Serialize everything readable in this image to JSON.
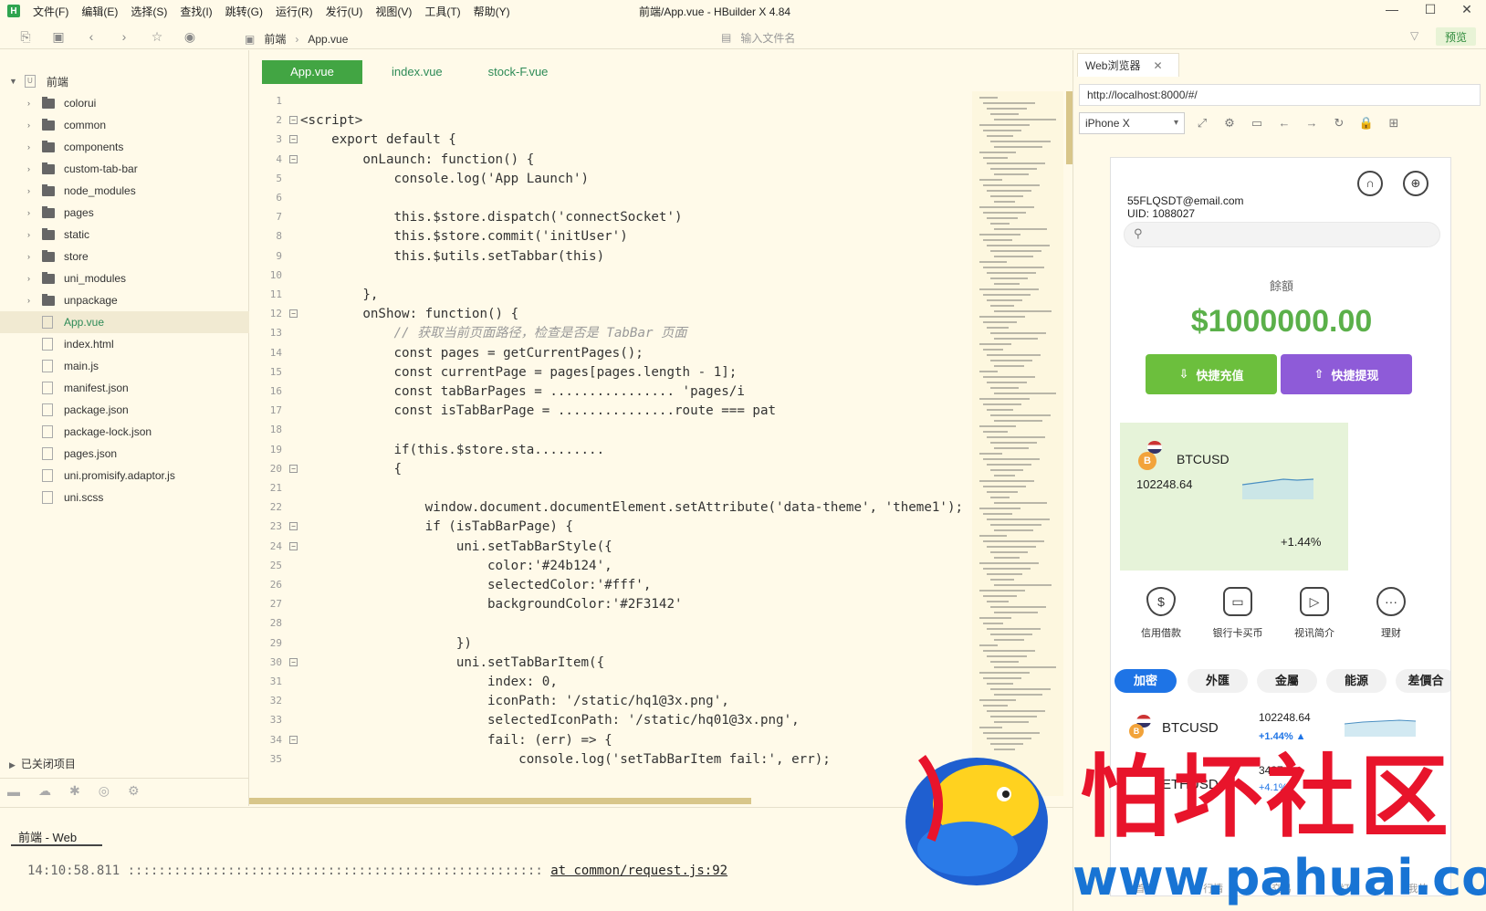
{
  "window": {
    "title": "前端/App.vue - HBuilder X 4.84",
    "logo": "H"
  },
  "menu": [
    "文件(F)",
    "编辑(E)",
    "选择(S)",
    "查找(I)",
    "跳转(G)",
    "运行(R)",
    "发行(U)",
    "视图(V)",
    "工具(T)",
    "帮助(Y)"
  ],
  "breadcrumb": {
    "project": "前端",
    "file": "App.vue"
  },
  "file_search": {
    "placeholder": "输入文件名"
  },
  "preview_label": "预览",
  "project_tree": {
    "root": "前端",
    "items": [
      {
        "label": "colorui",
        "type": "folder"
      },
      {
        "label": "common",
        "type": "folder"
      },
      {
        "label": "components",
        "type": "folder"
      },
      {
        "label": "custom-tab-bar",
        "type": "folder"
      },
      {
        "label": "node_modules",
        "type": "folder"
      },
      {
        "label": "pages",
        "type": "folder"
      },
      {
        "label": "static",
        "type": "folder"
      },
      {
        "label": "store",
        "type": "folder"
      },
      {
        "label": "uni_modules",
        "type": "folder"
      },
      {
        "label": "unpackage",
        "type": "folder"
      },
      {
        "label": "App.vue",
        "type": "file",
        "selected": true
      },
      {
        "label": "index.html",
        "type": "file"
      },
      {
        "label": "main.js",
        "type": "file"
      },
      {
        "label": "manifest.json",
        "type": "file"
      },
      {
        "label": "package.json",
        "type": "file"
      },
      {
        "label": "package-lock.json",
        "type": "file"
      },
      {
        "label": "pages.json",
        "type": "file"
      },
      {
        "label": "uni.promisify.adaptor.js",
        "type": "file"
      },
      {
        "label": "uni.scss",
        "type": "file"
      }
    ],
    "closed_projects": "已关闭项目"
  },
  "editor_tabs": [
    "App.vue",
    "index.vue",
    "stock-F.vue"
  ],
  "code_lines": [
    "",
    "<script>",
    "    export default {",
    "        onLaunch: function() {",
    "            console.log('App Launch')",
    "",
    "            this.$store.dispatch('connectSocket')",
    "            this.$store.commit('initUser')",
    "            this.$utils.setTabbar(this)",
    "",
    "        },",
    "        onShow: function() {",
    "            // 获取当前页面路径，检查是否是 TabBar 页面",
    "            const pages = getCurrentPages();",
    "            const currentPage = pages[pages.length - 1];",
    "            const tabBarPages = ................ 'pages/i",
    "            const isTabBarPage = ...............route === pat",
    "",
    "            if(this.$store.sta.........",
    "            {",
    "",
    "                window.document.documentElement.setAttribute('data-theme', 'theme1');",
    "                if (isTabBarPage) {",
    "                    uni.setTabBarStyle({",
    "                        color:'#24b124',",
    "                        selectedColor:'#fff',",
    "                        backgroundColor:'#2F3142'",
    "",
    "                    })",
    "                    uni.setTabBarItem({",
    "                        index: 0,",
    "                        iconPath: '/static/hq1@3x.png',",
    "                        selectedIconPath: '/static/hq01@3x.png',",
    "                        fail: (err) => {",
    "                            console.log('setTabBarItem fail:', err);"
  ],
  "bottom_panel": {
    "title": "前端 - Web",
    "console_time": "14:10:58.811",
    "console_dots": "::::::::::::::::::::::::::::::::::::::::::::::::::::::",
    "console_link": "at common/request.js:92"
  },
  "browser": {
    "tab_label": "Web浏览器",
    "url": "http://localhost:8000/#/",
    "device": "iPhone X"
  },
  "app": {
    "email": "55FLQSDT@email.com",
    "uid": "UID: 1088027",
    "balance_label": "餘額",
    "balance": "$1000000.00",
    "deposit_label": "快捷充值",
    "withdraw_label": "快捷提现",
    "card": {
      "symbol": "BTCUSD",
      "price": "102248.64",
      "change": "+1.44%"
    },
    "quick_actions": [
      "信用借款",
      "银行卡买币",
      "视讯简介",
      "理财"
    ],
    "categories": [
      "加密",
      "外匯",
      "金屬",
      "能源",
      "差價合"
    ],
    "list": [
      {
        "symbol": "BTCUSD",
        "price": "102248.64",
        "change": "+1.44%"
      },
      {
        "symbol": "ETHUSD",
        "price": "3437.9",
        "change": "+4.1%"
      }
    ],
    "bottom_nav": [
      "首頁",
      "行情",
      "交易",
      "訂單",
      "我的"
    ]
  },
  "watermark": {
    "cn": "怕坏社区",
    "url": "www.pahuai.com"
  },
  "colors": {
    "accent": "#42a543",
    "balance": "#5bb04a",
    "withdraw": "#8e5bd8",
    "deposit": "#6cbf3d",
    "category_active": "#1e74e6",
    "watermark_red": "#e8142b",
    "watermark_blue": "#1874d4"
  }
}
